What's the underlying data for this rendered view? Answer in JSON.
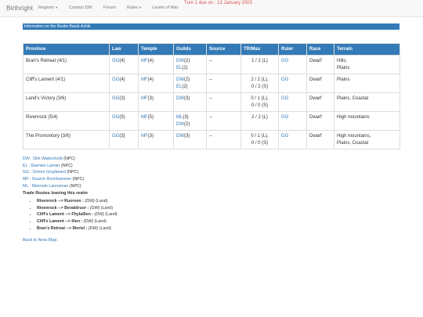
{
  "nav": {
    "brand": "Birthright",
    "items": [
      "Regions",
      "Contact DM",
      "Forum",
      "Rules",
      "Levels of War"
    ],
    "turn_notice": "Turn 1 due on : 13 January 2003"
  },
  "info_bar": "Information on the Realm Baruk-Azhik",
  "table": {
    "headers": [
      "Province",
      "Law",
      "Temple",
      "Guilds",
      "Source",
      "TR/Max",
      "Ruler",
      "Race",
      "Terrain"
    ],
    "rows": [
      {
        "province": "Bran's Retreat (4/1)",
        "law_code": "GG",
        "law_val": "(4)",
        "temple_code": "MF",
        "temple_val": "(4)",
        "guild1_code": "DW",
        "guild1_val": "(2)",
        "guild2_code": "EL",
        "guild2_val": "(2)",
        "source": "--",
        "tr1": "1 / 2 (L)",
        "tr2": "",
        "ruler": "GG",
        "race": "Dwarf",
        "terrain1": "Hills,",
        "terrain2": "Plains"
      },
      {
        "province": "Cliff's Lament (4/1)",
        "law_code": "GG",
        "law_val": "(4)",
        "temple_code": "MF",
        "temple_val": "(4)",
        "guild1_code": "DW",
        "guild1_val": "(2)",
        "guild2_code": "EL",
        "guild2_val": "(2)",
        "source": "--",
        "tr1": "2 / 2 (L),",
        "tr2": "0 / 2 (S)",
        "ruler": "GG",
        "race": "Dwarf",
        "terrain1": "Plains",
        "terrain2": ""
      },
      {
        "province": "Land's Victory (3/6)",
        "law_code": "GG",
        "law_val": "(3)",
        "temple_code": "MF",
        "temple_val": "(3)",
        "guild1_code": "DW",
        "guild1_val": "(3)",
        "guild2_code": "",
        "guild2_val": "",
        "source": "--",
        "tr1": "0 / 1 (L),",
        "tr2": "0 / 0 (S)",
        "ruler": "GG",
        "race": "Dwarf",
        "terrain1": "Plains, Coastal",
        "terrain2": ""
      },
      {
        "province": "Rivenrock (5/4)",
        "law_code": "GG",
        "law_val": "(5)",
        "temple_code": "MF",
        "temple_val": "(5)",
        "guild1_code": "ML",
        "guild1_val": "(3)",
        "guild2_code": "DW",
        "guild2_val": "(2)",
        "source": "--",
        "tr1": "2 / 2 (L)",
        "tr2": "",
        "ruler": "GG",
        "race": "Dwarf",
        "terrain1": "High mountains",
        "terrain2": ""
      },
      {
        "province": "The Promontory (3/6)",
        "law_code": "GG",
        "law_val": "(3)",
        "temple_code": "MF",
        "temple_val": "(3)",
        "guild1_code": "DW",
        "guild1_val": "(3)",
        "guild2_code": "",
        "guild2_val": "",
        "source": "--",
        "tr1": "0 / 1 (L),",
        "tr2": "0 / 0 (S)",
        "ruler": "GG",
        "race": "Dwarf",
        "terrain1": "High mountains,",
        "terrain2": "Plains, Coastal"
      }
    ]
  },
  "legend": [
    {
      "link": "DW : Dirk Watershold",
      "suffix": " (NPC)"
    },
    {
      "link": "EL : Elamien Lamier",
      "suffix": " (NPC)"
    },
    {
      "link": "GG : Grimm Graybeard",
      "suffix": " (NPC)"
    },
    {
      "link": "MF : Ruarch Rockhammer",
      "suffix": " (NPC)"
    },
    {
      "link": "ML : Moenele Lannaman",
      "suffix": " (NPC)"
    }
  ],
  "routes_title": "Trade Routes leaving this realm",
  "routes": [
    {
      "route": "Rivenrock --> Ruorven :",
      "owner": " (DW)",
      "type": " (Land)"
    },
    {
      "route": "Rivenrock --> Bevaldruor :",
      "owner": " (DW)",
      "type": " (Land)"
    },
    {
      "route": "Cliff's Lament --> Fhylallien :",
      "owner": " (DW)",
      "type": " (Land)"
    },
    {
      "route": "Cliff's Lament --> Ilien :",
      "owner": " (DW)",
      "type": " (Land)"
    },
    {
      "route": "Bran's Retreat --> Moriel :",
      "owner": " (DW)",
      "type": " (Land)"
    }
  ],
  "back_link": "Back to Area Map."
}
